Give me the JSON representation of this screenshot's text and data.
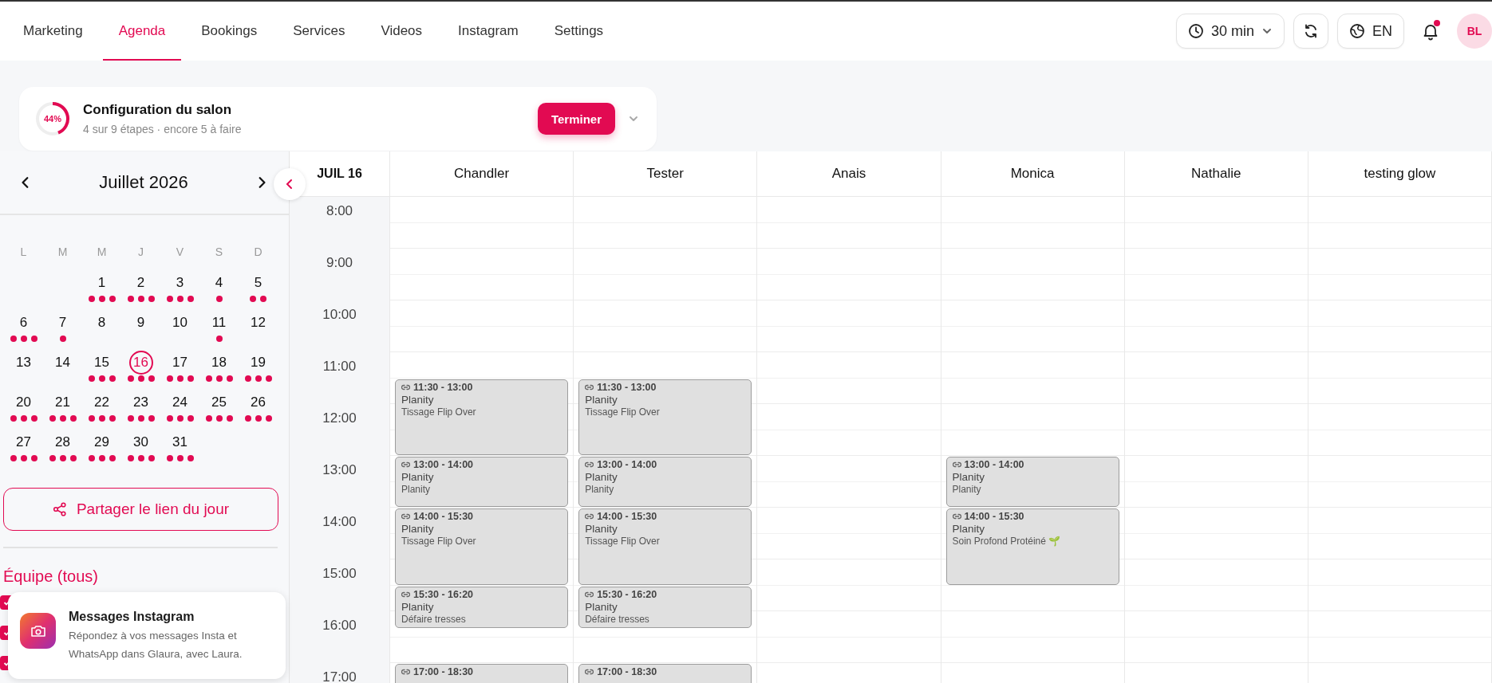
{
  "nav": {
    "tabs": [
      {
        "label": "Marketing",
        "selected": false
      },
      {
        "label": "Agenda",
        "selected": true
      },
      {
        "label": "Bookings",
        "selected": false
      },
      {
        "label": "Services",
        "selected": false
      },
      {
        "label": "Videos",
        "selected": false
      },
      {
        "label": "Instagram",
        "selected": false
      },
      {
        "label": "Settings",
        "selected": false
      }
    ]
  },
  "toolbar": {
    "slot_duration": "30 min",
    "language": "EN",
    "notifications": {
      "unread": true
    },
    "avatar": "BL"
  },
  "setup": {
    "progress_label": "44%",
    "level": 0.44,
    "title": "Configuration du salon",
    "subtitle": "4 sur 9 étapes · encore 5 à faire",
    "button": "Terminer"
  },
  "calendar": {
    "month": "Juillet 2026",
    "weekdays": [
      "L",
      "M",
      "M",
      "J",
      "V",
      "S",
      "D"
    ],
    "days": [
      {
        "day": "1",
        "selected": false,
        "dots": [
          {
            "color": "#e20a52"
          },
          {
            "color": "#e20a52"
          },
          {
            "color": "#e20a52"
          }
        ]
      },
      {
        "day": "2",
        "selected": false,
        "dots": [
          {
            "color": "#e20a52"
          },
          {
            "color": "#e20a52"
          },
          {
            "color": "#e20a52"
          }
        ]
      },
      {
        "day": "3",
        "selected": false,
        "dots": [
          {
            "color": "#e20a52"
          },
          {
            "color": "#e20a52"
          },
          {
            "color": "#e20a52"
          }
        ]
      },
      {
        "day": "4",
        "selected": false,
        "dots": [
          {
            "color": "#e20a52"
          }
        ]
      },
      {
        "day": "5",
        "selected": false,
        "dots": [
          {
            "color": "#e20a52"
          },
          {
            "color": "#e20a52"
          }
        ]
      },
      {
        "day": "6",
        "selected": false,
        "dots": [
          {
            "color": "#e20a52"
          },
          {
            "color": "#e20a52"
          },
          {
            "color": "#e20a52"
          }
        ]
      },
      {
        "day": "7",
        "selected": false,
        "dots": [
          {
            "color": "#e20a52"
          }
        ]
      },
      {
        "day": "8",
        "selected": false
      },
      {
        "day": "9",
        "selected": false
      },
      {
        "day": "10",
        "selected": false
      },
      {
        "day": "11",
        "selected": false,
        "dots": [
          {
            "color": "#e20a52"
          }
        ]
      },
      {
        "day": "12",
        "selected": false
      },
      {
        "day": "13",
        "selected": false
      },
      {
        "day": "14",
        "selected": false
      },
      {
        "day": "15",
        "selected": false,
        "dots": [
          {
            "color": "#e20a52"
          },
          {
            "color": "#e20a52"
          },
          {
            "color": "#e20a52"
          }
        ]
      },
      {
        "day": "16",
        "selected": true,
        "dots": [
          {
            "color": "#e20a52"
          },
          {
            "color": "#e20a52"
          },
          {
            "color": "#e20a52"
          }
        ]
      },
      {
        "day": "17",
        "selected": false,
        "dots": [
          {
            "color": "#e20a52"
          },
          {
            "color": "#e20a52"
          },
          {
            "color": "#e20a52"
          }
        ]
      },
      {
        "day": "18",
        "selected": false,
        "dots": [
          {
            "color": "#e20a52"
          },
          {
            "color": "#e20a52"
          },
          {
            "color": "#e20a52"
          }
        ]
      },
      {
        "day": "19",
        "selected": false,
        "dots": [
          {
            "color": "#e20a52"
          },
          {
            "color": "#e20a52"
          },
          {
            "color": "#e20a52"
          }
        ]
      },
      {
        "day": "20",
        "selected": false,
        "dots": [
          {
            "color": "#e20a52"
          },
          {
            "color": "#e20a52"
          },
          {
            "color": "#e20a52"
          }
        ]
      },
      {
        "day": "21",
        "selected": false,
        "dots": [
          {
            "color": "#e20a52"
          },
          {
            "color": "#e20a52"
          },
          {
            "color": "#e20a52"
          }
        ]
      },
      {
        "day": "22",
        "selected": false,
        "dots": [
          {
            "color": "#e20a52"
          },
          {
            "color": "#e20a52"
          },
          {
            "color": "#e20a52"
          }
        ]
      },
      {
        "day": "23",
        "selected": false,
        "dots": [
          {
            "color": "#e20a52"
          },
          {
            "color": "#e20a52"
          },
          {
            "color": "#e20a52"
          }
        ]
      },
      {
        "day": "24",
        "selected": false,
        "dots": [
          {
            "color": "#e20a52"
          },
          {
            "color": "#e20a52"
          },
          {
            "color": "#e20a52"
          }
        ]
      },
      {
        "day": "25",
        "selected": false,
        "dots": [
          {
            "color": "#e20a52"
          },
          {
            "color": "#e20a52"
          },
          {
            "color": "#e20a52"
          }
        ]
      },
      {
        "day": "26",
        "selected": false,
        "dots": [
          {
            "color": "#e20a52"
          },
          {
            "color": "#e20a52"
          },
          {
            "color": "#e20a52"
          }
        ]
      },
      {
        "day": "27",
        "selected": false,
        "dots": [
          {
            "color": "#e20a52"
          },
          {
            "color": "#e20a52"
          },
          {
            "color": "#e20a52"
          }
        ]
      },
      {
        "day": "28",
        "selected": false,
        "dots": [
          {
            "color": "#e20a52"
          },
          {
            "color": "#e20a52"
          },
          {
            "color": "#e20a52"
          }
        ]
      },
      {
        "day": "29",
        "selected": false,
        "dots": [
          {
            "color": "#e20a52"
          },
          {
            "color": "#e20a52"
          },
          {
            "color": "#e20a52"
          }
        ]
      },
      {
        "day": "30",
        "selected": false,
        "dots": [
          {
            "color": "#e20a52"
          },
          {
            "color": "#e20a52"
          },
          {
            "color": "#e20a52"
          }
        ]
      },
      {
        "day": "31",
        "selected": false,
        "dots": [
          {
            "color": "#e20a52"
          },
          {
            "color": "#e20a52"
          },
          {
            "color": "#e20a52"
          }
        ]
      }
    ]
  },
  "share_button": "Partager le lien du jour",
  "team": {
    "title": "Équipe (tous)",
    "members": [
      {
        "checked": true
      },
      {
        "checked": true
      },
      {
        "checked": true
      }
    ]
  },
  "schedule": {
    "date": "JUIL 16",
    "hours": [
      "8:00",
      "9:00",
      "10:00",
      "11:00",
      "12:00",
      "13:00",
      "14:00",
      "15:00",
      "16:00",
      "17:00"
    ],
    "staff": [
      {
        "name": "Chandler",
        "events": [
          {
            "time": "11:30 - 13:00",
            "client": "Planity",
            "service": "Tissage Flip Over"
          },
          {
            "time": "13:00 - 14:00",
            "client": "Planity",
            "service": "Planity"
          },
          {
            "time": "14:00 - 15:30",
            "client": "Planity",
            "service": "Tissage Flip Over"
          },
          {
            "time": "15:30 - 16:20",
            "client": "Planity",
            "service": "Défaire tresses"
          },
          {
            "time": "17:00 - 18:30"
          }
        ]
      },
      {
        "name": "Tester",
        "events": [
          {
            "time": "11:30 - 13:00",
            "client": "Planity",
            "service": "Tissage Flip Over"
          },
          {
            "time": "13:00 - 14:00",
            "client": "Planity",
            "service": "Planity"
          },
          {
            "time": "14:00 - 15:30",
            "client": "Planity",
            "service": "Tissage Flip Over"
          },
          {
            "time": "15:30 - 16:20",
            "client": "Planity",
            "service": "Défaire tresses"
          },
          {
            "time": "17:00 - 18:30"
          }
        ]
      },
      {
        "name": "Anais"
      },
      {
        "name": "Monica",
        "events": [
          {
            "time": "13:00 - 14:00",
            "client": "Planity",
            "service": "Planity"
          },
          {
            "time": "14:00 - 15:30",
            "client": "Planity",
            "service": "Soin Profond Protéiné 🌱"
          }
        ]
      },
      {
        "name": "Nathalie"
      },
      {
        "name": "testing glow"
      }
    ]
  },
  "popup": {
    "title": "Messages Instagram",
    "text": "Répondez à vos messages Insta et WhatsApp dans Glaura, avec Laura."
  }
}
